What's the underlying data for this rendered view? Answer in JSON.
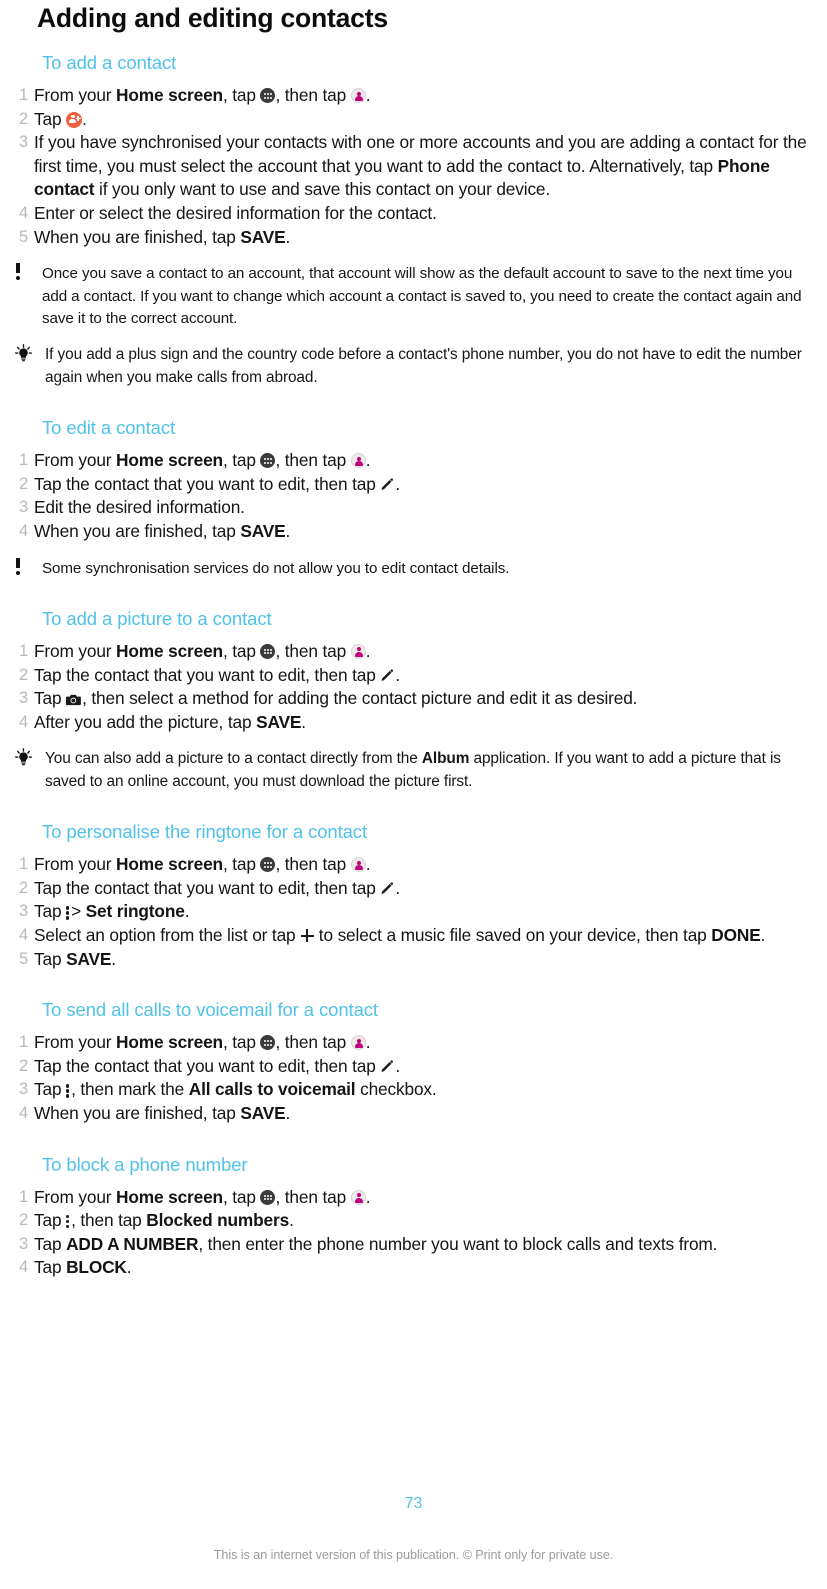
{
  "document": {
    "title": "Adding and editing contacts",
    "page_number": "73",
    "footer": "This is an internet version of this publication. © Print only for private use."
  },
  "colors": {
    "heading_blue": "#4fc2e9",
    "step_number_gray": "#b8b8b8",
    "contacts_icon_magenta": "#c2007b",
    "add_contact_fab_orange": "#f4603e",
    "app_drawer_dark": "#3b3b3b",
    "footer_gray": "#9a9a9a"
  },
  "sections": [
    {
      "heading": "To add a contact",
      "steps": [
        {
          "num": "1",
          "parts": [
            {
              "t": "text",
              "v": "From your "
            },
            {
              "t": "bold",
              "v": "Home screen"
            },
            {
              "t": "text",
              "v": ", tap "
            },
            {
              "t": "icon",
              "v": "app-drawer-icon"
            },
            {
              "t": "text",
              "v": ", then tap "
            },
            {
              "t": "icon",
              "v": "contacts-icon"
            },
            {
              "t": "text",
              "v": "."
            }
          ]
        },
        {
          "num": "2",
          "parts": [
            {
              "t": "text",
              "v": "Tap "
            },
            {
              "t": "icon",
              "v": "add-contact-icon"
            },
            {
              "t": "text",
              "v": "."
            }
          ]
        },
        {
          "num": "3",
          "parts": [
            {
              "t": "text",
              "v": "If you have synchronised your contacts with one or more accounts and you are adding a contact for the first time, you must select the account that you want to add the contact to. Alternatively, tap "
            },
            {
              "t": "bold",
              "v": "Phone contact"
            },
            {
              "t": "text",
              "v": " if you only want to use and save this contact on your device."
            }
          ]
        },
        {
          "num": "4",
          "parts": [
            {
              "t": "text",
              "v": "Enter or select the desired information for the contact."
            }
          ]
        },
        {
          "num": "5",
          "parts": [
            {
              "t": "text",
              "v": "When you are finished, tap "
            },
            {
              "t": "bold",
              "v": "SAVE"
            },
            {
              "t": "text",
              "v": "."
            }
          ]
        }
      ],
      "notes": [
        {
          "type": "warning",
          "text": "Once you save a contact to an account, that account will show as the default account to save to the next time you add a contact. If you want to change which account a contact is saved to, you need to create the contact again and save it to the correct account."
        },
        {
          "type": "tip",
          "text": "If you add a plus sign and the country code before a contact's phone number, you do not have to edit the number again when you make calls from abroad."
        }
      ]
    },
    {
      "heading": "To edit a contact",
      "steps": [
        {
          "num": "1",
          "parts": [
            {
              "t": "text",
              "v": "From your "
            },
            {
              "t": "bold",
              "v": "Home screen"
            },
            {
              "t": "text",
              "v": ", tap "
            },
            {
              "t": "icon",
              "v": "app-drawer-icon"
            },
            {
              "t": "text",
              "v": ", then tap "
            },
            {
              "t": "icon",
              "v": "contacts-icon"
            },
            {
              "t": "text",
              "v": "."
            }
          ]
        },
        {
          "num": "2",
          "parts": [
            {
              "t": "text",
              "v": "Tap the contact that you want to edit, then tap "
            },
            {
              "t": "icon",
              "v": "pencil-icon"
            },
            {
              "t": "text",
              "v": "."
            }
          ]
        },
        {
          "num": "3",
          "parts": [
            {
              "t": "text",
              "v": "Edit the desired information."
            }
          ]
        },
        {
          "num": "4",
          "parts": [
            {
              "t": "text",
              "v": "When you are finished, tap "
            },
            {
              "t": "bold",
              "v": "SAVE"
            },
            {
              "t": "text",
              "v": "."
            }
          ]
        }
      ],
      "notes": [
        {
          "type": "warning",
          "text": "Some synchronisation services do not allow you to edit contact details."
        }
      ]
    },
    {
      "heading": "To add a picture to a contact",
      "steps": [
        {
          "num": "1",
          "parts": [
            {
              "t": "text",
              "v": "From your "
            },
            {
              "t": "bold",
              "v": "Home screen"
            },
            {
              "t": "text",
              "v": ", tap "
            },
            {
              "t": "icon",
              "v": "app-drawer-icon"
            },
            {
              "t": "text",
              "v": ", then tap "
            },
            {
              "t": "icon",
              "v": "contacts-icon"
            },
            {
              "t": "text",
              "v": "."
            }
          ]
        },
        {
          "num": "2",
          "parts": [
            {
              "t": "text",
              "v": "Tap the contact that you want to edit, then tap "
            },
            {
              "t": "icon",
              "v": "pencil-icon"
            },
            {
              "t": "text",
              "v": "."
            }
          ]
        },
        {
          "num": "3",
          "parts": [
            {
              "t": "text",
              "v": "Tap "
            },
            {
              "t": "icon",
              "v": "camera-icon"
            },
            {
              "t": "text",
              "v": ", then select a method for adding the contact picture and edit it as desired."
            }
          ]
        },
        {
          "num": "4",
          "parts": [
            {
              "t": "text",
              "v": "After you add the picture, tap "
            },
            {
              "t": "bold",
              "v": "SAVE"
            },
            {
              "t": "text",
              "v": "."
            }
          ]
        }
      ],
      "notes": [
        {
          "type": "tip",
          "text_parts": [
            {
              "t": "text",
              "v": "You can also add a picture to a contact directly from the "
            },
            {
              "t": "bold",
              "v": "Album"
            },
            {
              "t": "text",
              "v": " application. If you want to add a picture that is saved to an online account, you must download the picture first."
            }
          ]
        }
      ]
    },
    {
      "heading": "To personalise the ringtone for a contact",
      "steps": [
        {
          "num": "1",
          "parts": [
            {
              "t": "text",
              "v": "From your "
            },
            {
              "t": "bold",
              "v": "Home screen"
            },
            {
              "t": "text",
              "v": ", tap "
            },
            {
              "t": "icon",
              "v": "app-drawer-icon"
            },
            {
              "t": "text",
              "v": ", then tap "
            },
            {
              "t": "icon",
              "v": "contacts-icon"
            },
            {
              "t": "text",
              "v": "."
            }
          ]
        },
        {
          "num": "2",
          "parts": [
            {
              "t": "text",
              "v": "Tap the contact that you want to edit, then tap "
            },
            {
              "t": "icon",
              "v": "pencil-icon"
            },
            {
              "t": "text",
              "v": "."
            }
          ]
        },
        {
          "num": "3",
          "parts": [
            {
              "t": "text",
              "v": "Tap "
            },
            {
              "t": "icon",
              "v": "overflow-menu-icon"
            },
            {
              "t": "text",
              "v": "> "
            },
            {
              "t": "bold",
              "v": "Set ringtone"
            },
            {
              "t": "text",
              "v": "."
            }
          ]
        },
        {
          "num": "4",
          "parts": [
            {
              "t": "text",
              "v": "Select an option from the list or tap "
            },
            {
              "t": "icon",
              "v": "plus-icon"
            },
            {
              "t": "text",
              "v": " to select a music file saved on your device, then tap "
            },
            {
              "t": "bold",
              "v": "DONE"
            },
            {
              "t": "text",
              "v": "."
            }
          ]
        },
        {
          "num": "5",
          "parts": [
            {
              "t": "text",
              "v": "Tap "
            },
            {
              "t": "bold",
              "v": "SAVE"
            },
            {
              "t": "text",
              "v": "."
            }
          ]
        }
      ],
      "notes": []
    },
    {
      "heading": "To send all calls to voicemail for a contact",
      "steps": [
        {
          "num": "1",
          "parts": [
            {
              "t": "text",
              "v": "From your "
            },
            {
              "t": "bold",
              "v": "Home screen"
            },
            {
              "t": "text",
              "v": ", tap "
            },
            {
              "t": "icon",
              "v": "app-drawer-icon"
            },
            {
              "t": "text",
              "v": ", then tap "
            },
            {
              "t": "icon",
              "v": "contacts-icon"
            },
            {
              "t": "text",
              "v": "."
            }
          ]
        },
        {
          "num": "2",
          "parts": [
            {
              "t": "text",
              "v": "Tap the contact that you want to edit, then tap "
            },
            {
              "t": "icon",
              "v": "pencil-icon"
            },
            {
              "t": "text",
              "v": "."
            }
          ]
        },
        {
          "num": "3",
          "parts": [
            {
              "t": "text",
              "v": "Tap "
            },
            {
              "t": "icon",
              "v": "overflow-menu-icon"
            },
            {
              "t": "text",
              "v": ", then mark the "
            },
            {
              "t": "bold",
              "v": "All calls to voicemail"
            },
            {
              "t": "text",
              "v": " checkbox."
            }
          ]
        },
        {
          "num": "4",
          "parts": [
            {
              "t": "text",
              "v": "When you are finished, tap "
            },
            {
              "t": "bold",
              "v": "SAVE"
            },
            {
              "t": "text",
              "v": "."
            }
          ]
        }
      ],
      "notes": []
    },
    {
      "heading": "To block a phone number",
      "steps": [
        {
          "num": "1",
          "parts": [
            {
              "t": "text",
              "v": "From your "
            },
            {
              "t": "bold",
              "v": "Home screen"
            },
            {
              "t": "text",
              "v": ", tap "
            },
            {
              "t": "icon",
              "v": "app-drawer-icon"
            },
            {
              "t": "text",
              "v": ", then tap "
            },
            {
              "t": "icon",
              "v": "contacts-icon"
            },
            {
              "t": "text",
              "v": "."
            }
          ]
        },
        {
          "num": "2",
          "parts": [
            {
              "t": "text",
              "v": "Tap "
            },
            {
              "t": "icon",
              "v": "overflow-menu-icon"
            },
            {
              "t": "text",
              "v": ", then tap "
            },
            {
              "t": "bold",
              "v": "Blocked numbers"
            },
            {
              "t": "text",
              "v": "."
            }
          ]
        },
        {
          "num": "3",
          "parts": [
            {
              "t": "text",
              "v": "Tap "
            },
            {
              "t": "bold",
              "v": "ADD A NUMBER"
            },
            {
              "t": "text",
              "v": ", then enter the phone number you want to block calls and texts from."
            }
          ]
        },
        {
          "num": "4",
          "parts": [
            {
              "t": "text",
              "v": "Tap "
            },
            {
              "t": "bold",
              "v": "BLOCK"
            },
            {
              "t": "text",
              "v": "."
            }
          ]
        }
      ],
      "notes": []
    }
  ]
}
